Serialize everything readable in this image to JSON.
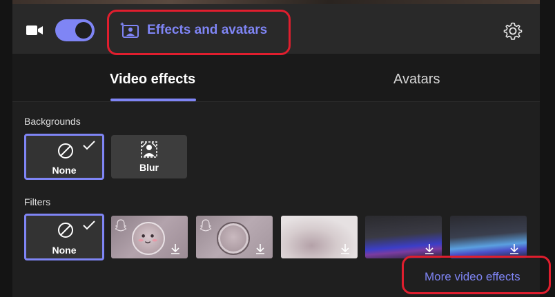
{
  "toolbar": {
    "camera_icon": "video-camera-icon",
    "toggle_state": "on",
    "effects_label": "Effects and avatars",
    "effects_icon": "effects-avatar-icon",
    "settings_icon": "gear-icon"
  },
  "tabs": [
    {
      "label": "Video effects",
      "active": true
    },
    {
      "label": "Avatars",
      "active": false
    }
  ],
  "backgrounds": {
    "label": "Backgrounds",
    "options": [
      {
        "label": "None",
        "icon": "none-circle-slash-icon",
        "selected": true
      },
      {
        "label": "Blur",
        "icon": "blur-icon",
        "selected": false
      }
    ]
  },
  "filters": {
    "label": "Filters",
    "none": {
      "label": "None",
      "icon": "none-circle-slash-icon",
      "selected": true
    },
    "thumbnails": [
      {
        "name": "snap-face-filter",
        "has_snap_icon": true
      },
      {
        "name": "snap-circle-filter",
        "has_snap_icon": true
      },
      {
        "name": "pastel-filter",
        "has_snap_icon": false
      },
      {
        "name": "purple-wave-filter",
        "has_snap_icon": false
      },
      {
        "name": "blue-wave-filter",
        "has_snap_icon": false
      }
    ]
  },
  "more_effects_label": "More video effects",
  "colors": {
    "accent": "#7f85f5",
    "annotation": "#e01e2e",
    "panel_bg": "#1f1f1f",
    "toolbar_bg": "#292929"
  }
}
